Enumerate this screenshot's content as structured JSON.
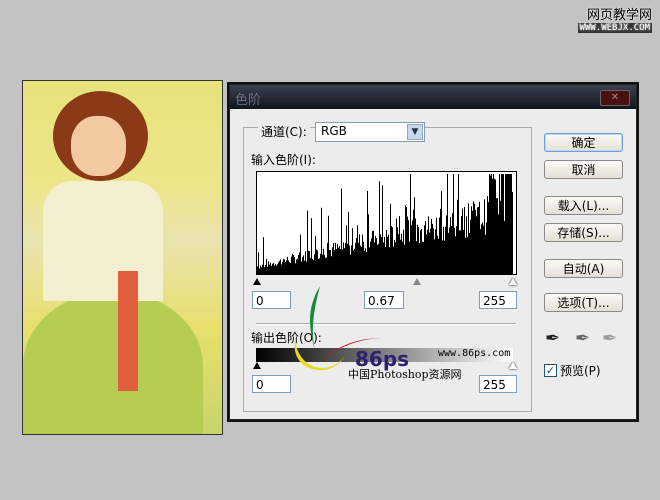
{
  "watermark": {
    "site_name": "网页教学网",
    "url": "WWW.WEBJX.COM"
  },
  "dialog": {
    "title": "色阶",
    "close_label": "✕",
    "channel": {
      "label": "通道(C):",
      "value": "RGB"
    },
    "input_levels": {
      "label": "输入色阶(I):",
      "black": "0",
      "gamma": "0.67",
      "white": "255"
    },
    "output_levels": {
      "label": "输出色阶(O):",
      "black": "0",
      "white": "255"
    },
    "buttons": {
      "ok": "确定",
      "cancel": "取消",
      "load": "载入(L)...",
      "save": "存储(S)...",
      "auto": "自动(A)",
      "options": "选项(T)..."
    },
    "preview": {
      "label": "预览(P)",
      "checked": true
    }
  },
  "logo": {
    "brand": "86ps",
    "url": "www.86ps.com",
    "name": "中国Photoshop资源网"
  }
}
